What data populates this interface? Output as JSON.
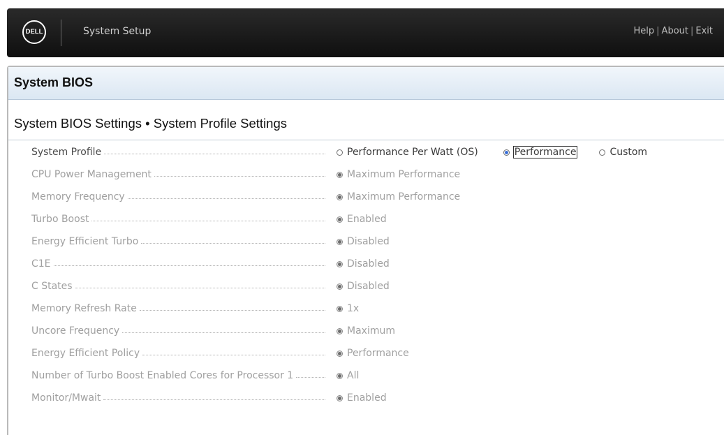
{
  "header": {
    "logo_text": "DELL",
    "app_title": "System Setup",
    "links": {
      "help": "Help",
      "about": "About",
      "exit": "Exit",
      "separator": "|"
    }
  },
  "page": {
    "title": "System BIOS",
    "subtitle": "System BIOS Settings • System Profile Settings"
  },
  "settings": [
    {
      "label": "System Profile",
      "enabled": true,
      "options": [
        {
          "text": "Performance Per Watt (OS)",
          "selected": false
        },
        {
          "text": "Performance",
          "selected": true,
          "focused": true
        },
        {
          "text": "Custom",
          "selected": false
        }
      ]
    },
    {
      "label": "CPU Power Management",
      "enabled": false,
      "options": [
        {
          "text": "Maximum Performance",
          "selected": true
        }
      ]
    },
    {
      "label": "Memory Frequency",
      "enabled": false,
      "options": [
        {
          "text": "Maximum Performance",
          "selected": true
        }
      ]
    },
    {
      "label": "Turbo Boost",
      "enabled": false,
      "options": [
        {
          "text": "Enabled",
          "selected": true
        }
      ]
    },
    {
      "label": "Energy Efficient Turbo",
      "enabled": false,
      "options": [
        {
          "text": "Disabled",
          "selected": true
        }
      ]
    },
    {
      "label": "C1E",
      "enabled": false,
      "options": [
        {
          "text": "Disabled",
          "selected": true
        }
      ]
    },
    {
      "label": "C States",
      "enabled": false,
      "options": [
        {
          "text": "Disabled",
          "selected": true
        }
      ]
    },
    {
      "label": "Memory Refresh Rate",
      "enabled": false,
      "options": [
        {
          "text": "1x",
          "selected": true
        }
      ]
    },
    {
      "label": "Uncore Frequency",
      "enabled": false,
      "options": [
        {
          "text": "Maximum",
          "selected": true
        }
      ]
    },
    {
      "label": "Energy Efficient Policy",
      "enabled": false,
      "options": [
        {
          "text": "Performance",
          "selected": true
        }
      ]
    },
    {
      "label": "Number of Turbo Boost Enabled Cores for Processor 1",
      "enabled": false,
      "options": [
        {
          "text": "All",
          "selected": true
        }
      ]
    },
    {
      "label": "Monitor/Mwait",
      "enabled": false,
      "options": [
        {
          "text": "Enabled",
          "selected": true
        }
      ]
    }
  ],
  "colors": {
    "header_bg": "#141414",
    "titlebar_bg": "#dbe7f3",
    "selected_radio": "#3a6fd8",
    "disabled_text": "#a0a0a0"
  }
}
